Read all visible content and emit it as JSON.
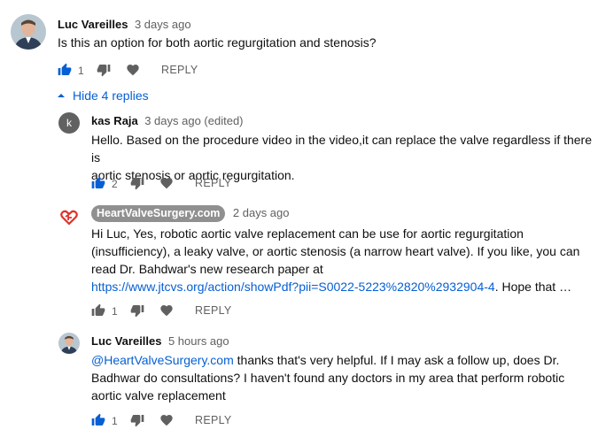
{
  "comment": {
    "author": "Luc Vareilles",
    "time": "3 days ago",
    "text": "Is this an option for both aortic regurgitation and stenosis?",
    "likes": "1",
    "reply_label": "REPLY"
  },
  "hide_replies_label": "Hide 4 replies",
  "replies": [
    {
      "author": "kas Raja",
      "avatar_letter": "k",
      "time": "3 days ago (edited)",
      "text_line1": "Hello. Based on the procedure video in the video,it can replace the valve regardless if there is",
      "text_line2": "aortic stenosis or aortic regurgitation.",
      "likes": "2",
      "reply_label": "REPLY"
    },
    {
      "author": "HeartValveSurgery.com",
      "time": "2 days ago",
      "text_line1": "Hi Luc,  Yes, robotic aortic valve replacement can be use for aortic regurgitation",
      "text_line2": "(insufficiency), a leaky valve, or aortic stenosis (a narrow heart valve).  If you like, you can",
      "text_line3": "read Dr. Bahdwar's new research paper at",
      "link": "https://www.jtcvs.org/action/showPdf?pii=S0022-5223%2820%2932904-4",
      "text_after_link": ".  Hope that …",
      "likes": "1",
      "reply_label": "REPLY"
    },
    {
      "author": "Luc Vareilles",
      "time": "5 hours ago",
      "mention": "@HeartValveSurgery.com",
      "text_line1_rest": " thanks that's very helpful. If I may ask a follow up, does Dr.",
      "text_line2": "Badhwar do consultations? I haven't found any doctors in my area that perform robotic",
      "text_line3": "aortic valve replacement",
      "likes": "1",
      "reply_label": "REPLY"
    }
  ],
  "colors": {
    "link": "#065fd4",
    "like_active": "#065fd4",
    "icon_gray": "#606060",
    "heart_logo": "#e0322a"
  },
  "icons": {
    "like": "thumb-up-icon",
    "dislike": "thumb-down-icon",
    "heart": "heart-icon",
    "collapse": "caret-up-icon"
  }
}
